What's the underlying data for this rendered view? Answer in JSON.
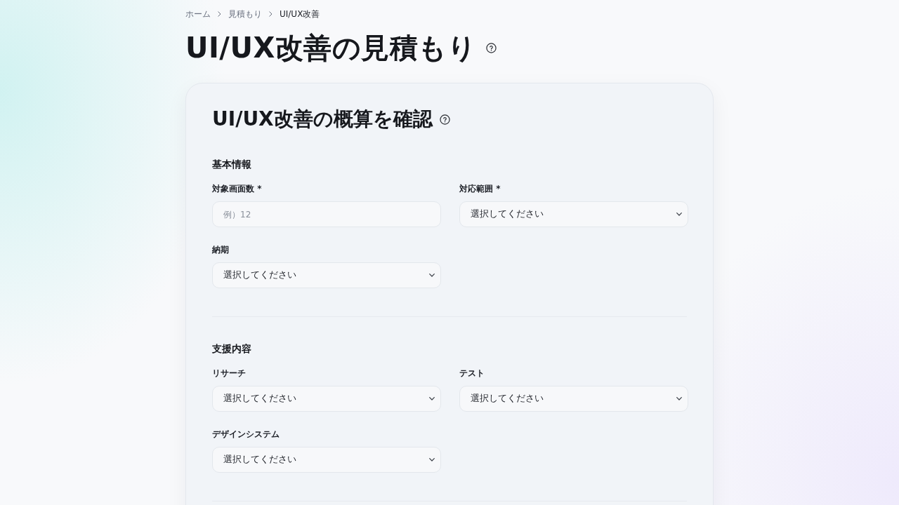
{
  "breadcrumb": [
    {
      "label": "ホーム",
      "current": false
    },
    {
      "label": "見積もり",
      "current": false
    },
    {
      "label": "UI/UX改善",
      "current": true
    }
  ],
  "page_title": "UI/UX改善の見積もり",
  "card": {
    "title": "UI/UX改善の概算を確認",
    "sections": [
      {
        "heading": "基本情報",
        "fields": [
          {
            "kind": "input",
            "label": "対象画面数 *",
            "placeholder": "例）12"
          },
          {
            "kind": "select",
            "label": "対応範囲 *",
            "value": "選択してください"
          },
          {
            "kind": "select",
            "label": "納期",
            "value": "選択してください"
          }
        ]
      },
      {
        "heading": "支援内容",
        "fields": [
          {
            "kind": "select",
            "label": "リサーチ",
            "value": "選択してください"
          },
          {
            "kind": "select",
            "label": "テスト",
            "value": "選択してください"
          },
          {
            "kind": "select",
            "label": "デザインシステム",
            "value": "選択してください"
          }
        ]
      }
    ]
  }
}
